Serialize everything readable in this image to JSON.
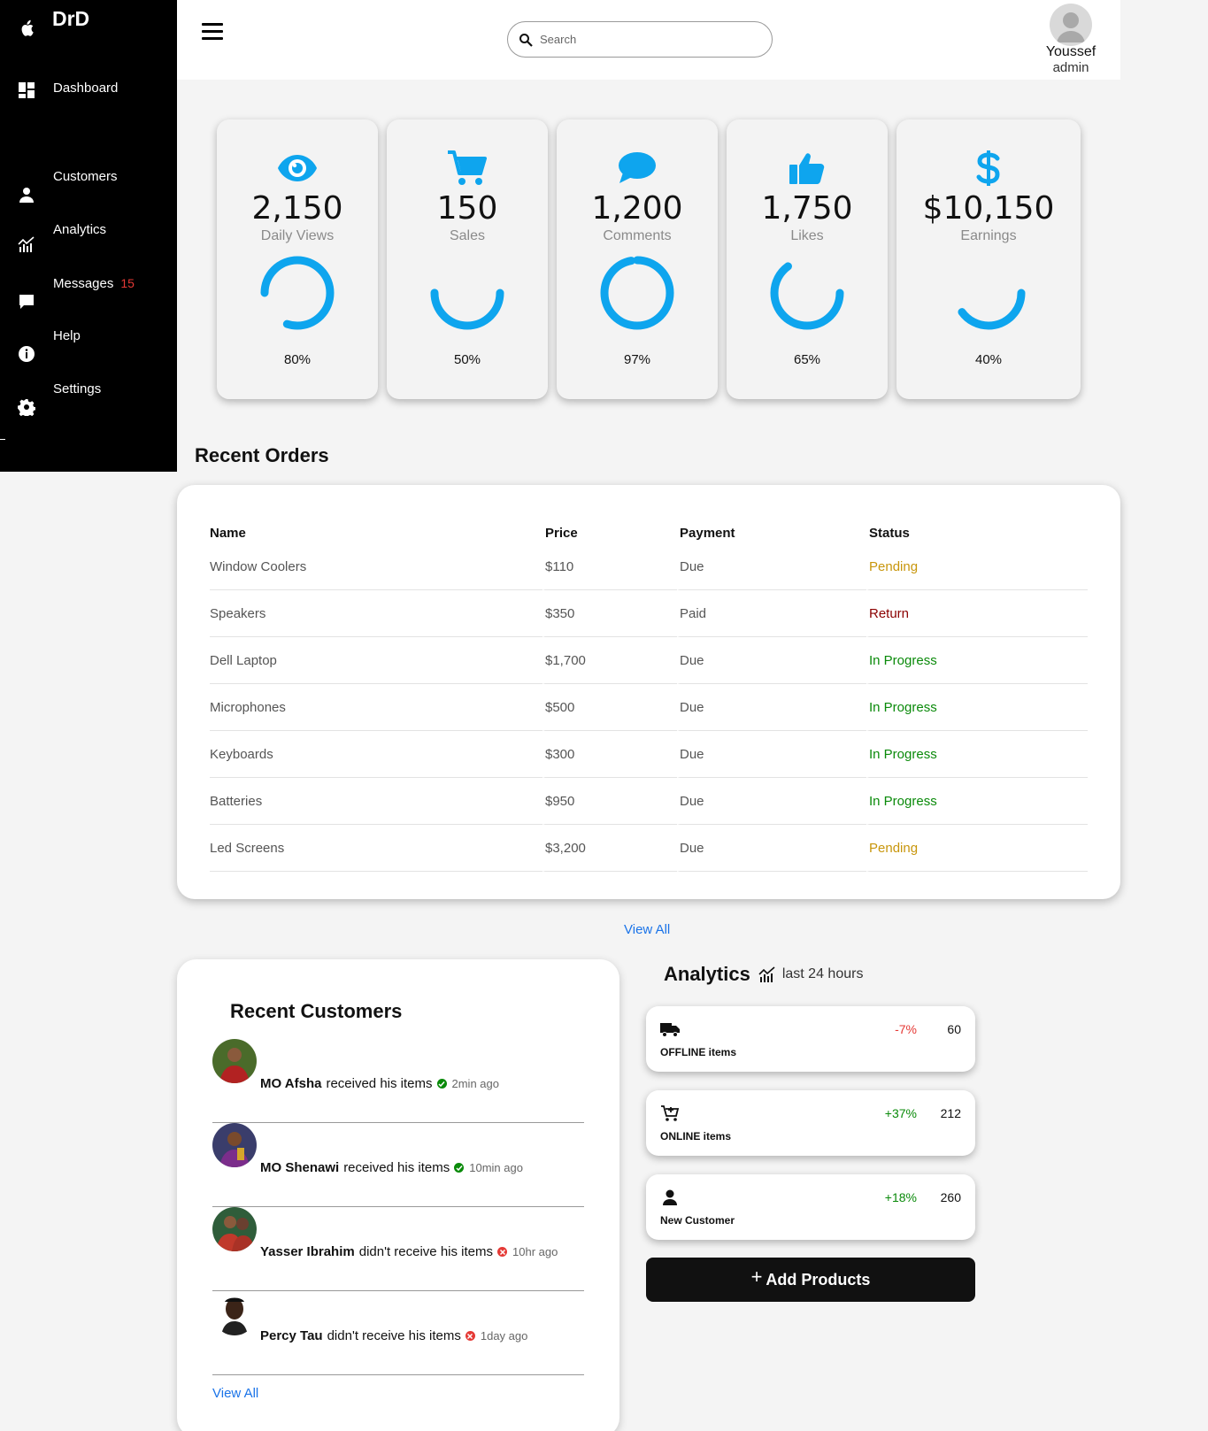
{
  "sidebar": {
    "brand": "DrD",
    "items": [
      {
        "label": "Dashboard",
        "icon": "dashboard-icon"
      },
      {
        "label": "Customers",
        "icon": "user-icon"
      },
      {
        "label": "Analytics",
        "icon": "chart-icon"
      },
      {
        "label": "Messages",
        "icon": "message-icon",
        "badge": "15"
      },
      {
        "label": "Help",
        "icon": "info-icon"
      },
      {
        "label": "Settings",
        "icon": "gear-icon"
      }
    ]
  },
  "header": {
    "search_placeholder": "Search",
    "user_name": "Youssef",
    "user_role": "admin"
  },
  "stats": [
    {
      "value": "2,150",
      "label": "Daily Views",
      "percent": 80,
      "percent_label": "80%",
      "icon": "eye-icon"
    },
    {
      "value": "150",
      "label": "Sales",
      "percent": 50,
      "percent_label": "50%",
      "icon": "cart-icon"
    },
    {
      "value": "1,200",
      "label": "Comments",
      "percent": 97,
      "percent_label": "97%",
      "icon": "comment-icon"
    },
    {
      "value": "1,750",
      "label": "Likes",
      "percent": 65,
      "percent_label": "65%",
      "icon": "thumbs-up-icon"
    },
    {
      "value": "$10,150",
      "label": "Earnings",
      "percent": 40,
      "percent_label": "40%",
      "icon": "dollar-icon"
    }
  ],
  "orders": {
    "title": "Recent Orders",
    "columns": [
      "Name",
      "Price",
      "Payment",
      "Status"
    ],
    "rows": [
      {
        "name": "Window Coolers",
        "price": "$110",
        "payment": "Due",
        "status": "Pending"
      },
      {
        "name": "Speakers",
        "price": "$350",
        "payment": "Paid",
        "status": "Return"
      },
      {
        "name": "Dell Laptop",
        "price": "$1,700",
        "payment": "Due",
        "status": "In Progress"
      },
      {
        "name": "Microphones",
        "price": "$500",
        "payment": "Due",
        "status": "In Progress"
      },
      {
        "name": "Keyboards",
        "price": "$300",
        "payment": "Due",
        "status": "In Progress"
      },
      {
        "name": "Batteries",
        "price": "$950",
        "payment": "Due",
        "status": "In Progress"
      },
      {
        "name": "Led Screens",
        "price": "$3,200",
        "payment": "Due",
        "status": "Pending"
      }
    ],
    "view_all": "View All",
    "status_colors": {
      "Pending": "#c8960c",
      "Return": "#8b0000",
      "In Progress": "#0a8a0a"
    }
  },
  "customers": {
    "title": "Recent Customers",
    "items": [
      {
        "name": "MO Afsha",
        "action": "received his items",
        "time": "2min ago",
        "ok": true
      },
      {
        "name": "MO Shenawi",
        "action": "received his items",
        "time": "10min ago",
        "ok": true
      },
      {
        "name": "Yasser Ibrahim",
        "action": "didn't receive his items",
        "time": "10hr ago",
        "ok": false
      },
      {
        "name": "Percy Tau",
        "action": "didn't receive his items",
        "time": "1day ago",
        "ok": false
      }
    ],
    "view_all": "View All"
  },
  "analytics": {
    "title": "Analytics",
    "subtitle": "last 24 hours",
    "cards": [
      {
        "label": "OFFLINE items",
        "change": "-7%",
        "count": "60",
        "icon": "truck-icon",
        "color": "#e53935"
      },
      {
        "label": "ONLINE items",
        "change": "+37%",
        "count": "212",
        "icon": "cart-plus-icon",
        "color": "#0a8a0a"
      },
      {
        "label": "New Customer",
        "change": "+18%",
        "count": "260",
        "icon": "user-icon",
        "color": "#0a8a0a"
      }
    ],
    "add_button": "Add Products"
  },
  "accent": "#0ea5ee"
}
